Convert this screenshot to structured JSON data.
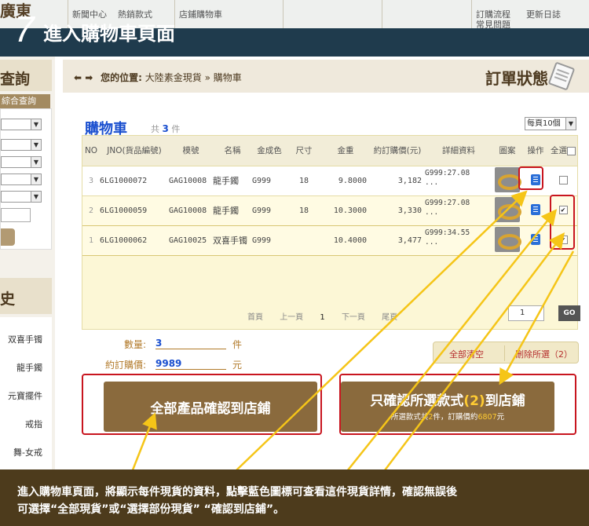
{
  "banner": {
    "step_number": "7",
    "step_title": "進入購物車頁面",
    "logo_text": "廣東",
    "nav_items": [
      "新聞中心",
      "熱銷款式",
      "店鋪購物車",
      "訂購流程",
      "更新日誌",
      "常見問題"
    ]
  },
  "sidebar": {
    "query_title": "查詢",
    "query_tab": "綜合查詢",
    "history_title": "史",
    "history_items": [
      "双喜手镯",
      "龍手鐲",
      "元寶擺件",
      "戒指",
      "舞-女戒"
    ]
  },
  "header": {
    "breadcrumb_label": "您的位置:",
    "breadcrumb_path": "大陸素金現貨 » 購物車",
    "order_status": "訂單狀態"
  },
  "cart": {
    "title": "購物車",
    "count_prefix": "共",
    "count": "3",
    "count_suffix": "件",
    "per_page": "每頁10個",
    "columns": [
      "NO",
      "JNO(貨品編號)",
      "模號",
      "名稱",
      "金成色",
      "尺寸",
      "金重",
      "約訂購價(元)",
      "詳細資料",
      "圖案",
      "操作",
      "全選"
    ],
    "rows": [
      {
        "no": "3",
        "jno": "6LG1000072",
        "model": "GAG10008",
        "name": "龍手鐲",
        "purity": "G999",
        "size": "18",
        "weight": "9.8000",
        "price": "3,182",
        "detail1": "G999:27.08",
        "detail2": "...",
        "checked": false
      },
      {
        "no": "2",
        "jno": "6LG1000059",
        "model": "GAG10008",
        "name": "龍手鐲",
        "purity": "G999",
        "size": "18",
        "weight": "10.3000",
        "price": "3,330",
        "detail1": "G999:27.08",
        "detail2": "...",
        "checked": true
      },
      {
        "no": "1",
        "jno": "6LG1000062",
        "model": "GAG10025",
        "name": "双喜手镯",
        "purity": "G999",
        "size": "",
        "weight": "10.4000",
        "price": "3,477",
        "detail1": "G999:34.55",
        "detail2": "...",
        "checked": true
      }
    ],
    "pager": {
      "first": "首頁",
      "prev": "上一頁",
      "current": "1",
      "next": "下一頁",
      "last": "尾頁",
      "page_input": "1",
      "go": "GO"
    },
    "clear_all": "全部清空",
    "delete_selected": "刪除所選（2）"
  },
  "summary": {
    "qty_label": "數量:",
    "qty_value": "3",
    "qty_unit": "件",
    "price_label": "約訂購價:",
    "price_value": "9989",
    "price_unit": "元"
  },
  "buttons": {
    "confirm_all": "全部產品確認到店鋪",
    "confirm_selected_a": "只確認所選款式",
    "confirm_selected_n": "(2)",
    "confirm_selected_b": "到店鋪",
    "selected_sub_a": "所選款式共",
    "selected_sub_n": "2",
    "selected_sub_b": "件，訂購價約",
    "selected_sub_price": "6807",
    "selected_sub_unit": "元"
  },
  "caption": {
    "line1": "進入購物車頁面，將顯示每件現貨的資料，點擊藍色圖標可查看這件現貨詳情，確認無誤後",
    "line2": "可選擇“全部現貨”或“選擇部份現貨” “確認到店鋪”。"
  },
  "colors": {
    "accent_red": "#c8151f",
    "arrow_yellow": "#f5c518",
    "brand_brown": "#8a6a3d",
    "link_blue": "#1a4fcf"
  }
}
